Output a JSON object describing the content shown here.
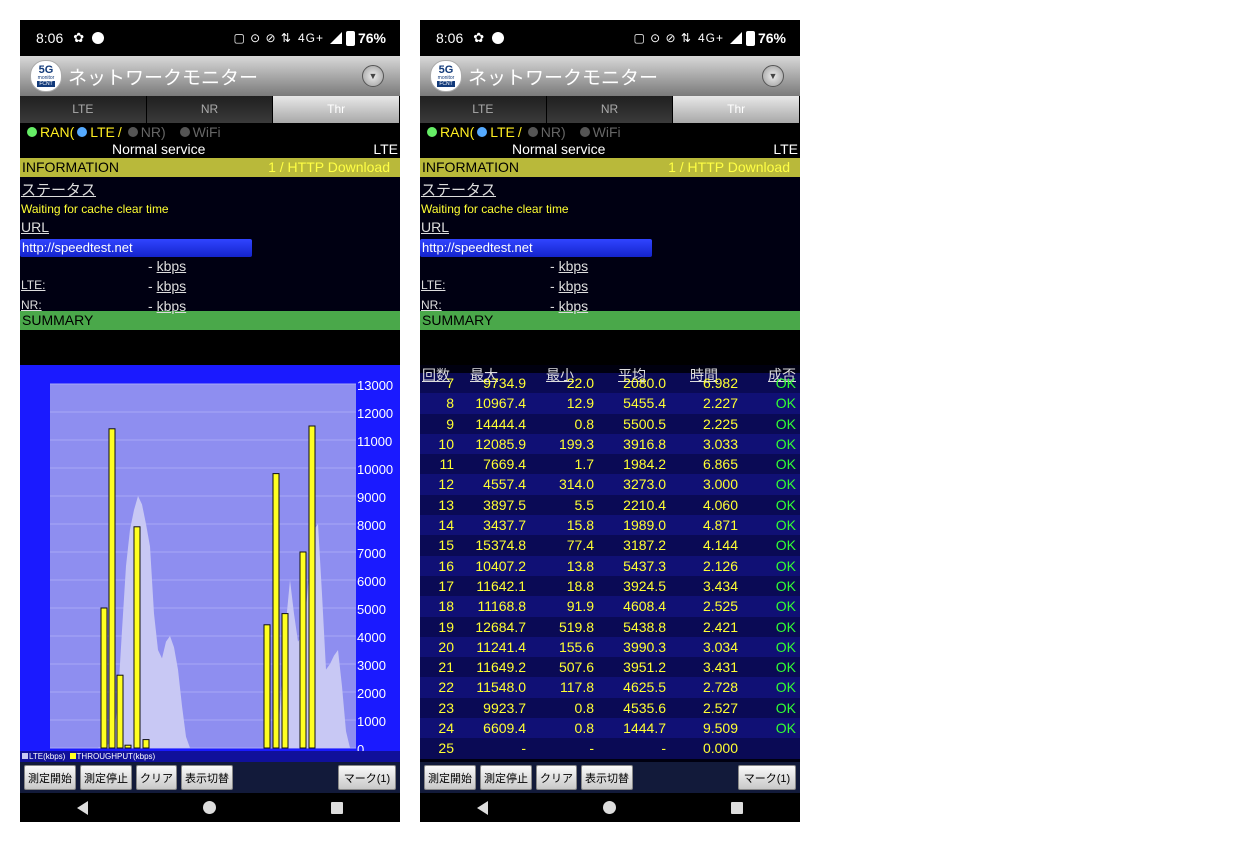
{
  "status_bar": {
    "time": "8:06",
    "network": "4G+",
    "battery": "76%"
  },
  "app": {
    "title": "ネットワークモニター",
    "logo_line1": "5G",
    "logo_line2": "monitor",
    "logo_line3": "FCNT"
  },
  "tabs": [
    "LTE",
    "NR",
    "Thr"
  ],
  "active_tab": "Thr",
  "ran": {
    "ran_label": "RAN",
    "open_paren": "(",
    "lte_label": "LTE",
    "slash": "/",
    "nr_label": "NR",
    "close_paren": ")",
    "wifi_label": "WiFi",
    "service": "Normal service",
    "network": "LTE"
  },
  "information": {
    "label": "INFORMATION",
    "value": "1 / HTTP Download",
    "status_label": "ステータス",
    "status_value": "Waiting for cache clear time",
    "url_label": "URL",
    "url_value": "http://speedtest.net",
    "total_rate": "- ",
    "lte_label": "LTE:",
    "lte_rate": "- ",
    "nr_label": "NR:",
    "nr_rate": "- ",
    "unit": "kbps"
  },
  "summary_label": "SUMMARY",
  "chart_data": {
    "type": "bar",
    "title": "",
    "ylim": [
      0,
      13000
    ],
    "y_ticks": [
      "13000",
      "12000",
      "11000",
      "10000",
      "9000",
      "8000",
      "7000",
      "6000",
      "5000",
      "4000",
      "3000",
      "2000",
      "1000",
      "0"
    ],
    "series": [
      {
        "name": "LTE(kbps)",
        "kind": "area",
        "color": "#c8c8f4",
        "values": [
          0,
          0,
          0,
          0,
          0,
          0,
          0,
          0,
          0,
          0,
          0,
          0,
          0,
          0,
          0,
          0,
          0,
          0,
          1500,
          4500,
          7500,
          9000,
          7500,
          6500,
          4800,
          3200,
          3800,
          4000,
          2000,
          800,
          0,
          0,
          0,
          0,
          0,
          0,
          0,
          0,
          0,
          0,
          0,
          0,
          0,
          0,
          0,
          0,
          0,
          0,
          0,
          0,
          0,
          0,
          0,
          0,
          0,
          0,
          0,
          0,
          0,
          0,
          0,
          0,
          0,
          0,
          0,
          0,
          0,
          0,
          0,
          0,
          0,
          0,
          0,
          0,
          0,
          0,
          0,
          0,
          0,
          0,
          0,
          0,
          0,
          0,
          0,
          0,
          0,
          0,
          0,
          0,
          0,
          0,
          0,
          0,
          0,
          0,
          0,
          0,
          0,
          0,
          0,
          0,
          0,
          0,
          0,
          0,
          0,
          0,
          0,
          0,
          0,
          0,
          0,
          0,
          0,
          0,
          0,
          0,
          0,
          0,
          0,
          0,
          0,
          0,
          0,
          0,
          0,
          0,
          0,
          0,
          0,
          0,
          0,
          0,
          0,
          0,
          0,
          0,
          0,
          0,
          0,
          0,
          0,
          0,
          0,
          0,
          0,
          0,
          0,
          0,
          0,
          0,
          0,
          0,
          0,
          0,
          0,
          0,
          0,
          0,
          0,
          0,
          0,
          0,
          0,
          0,
          0,
          0,
          0,
          0,
          0,
          0,
          0,
          0,
          0,
          0,
          0,
          0,
          0,
          0,
          0,
          0,
          0,
          0,
          0,
          0,
          0,
          0,
          0,
          0,
          0,
          0,
          0,
          0,
          0,
          0,
          0,
          0,
          0,
          0,
          0,
          0,
          0,
          0,
          0,
          0,
          0,
          0,
          0,
          0,
          0,
          0,
          0,
          0,
          0,
          0,
          0,
          0,
          0,
          0,
          0,
          0,
          0,
          0,
          0,
          0,
          0,
          0,
          0,
          0,
          0,
          0,
          0,
          0,
          0,
          0,
          0,
          0,
          0,
          0,
          0,
          0,
          0,
          0,
          0,
          0,
          0,
          0,
          0,
          0,
          0,
          0,
          0,
          0,
          0,
          0,
          0,
          0,
          0,
          0,
          0,
          0,
          0,
          0,
          0,
          0,
          0,
          0,
          0,
          0,
          0,
          0,
          0,
          0,
          0,
          0,
          0,
          0,
          0,
          0,
          0,
          0,
          0,
          0,
          0,
          0,
          0,
          0,
          0,
          0,
          0,
          0,
          0,
          0,
          0,
          0,
          0,
          0,
          0,
          0,
          0,
          0,
          0,
          0,
          0,
          0,
          0,
          0,
          0,
          0,
          0,
          0,
          0,
          0,
          0,
          0,
          0,
          0,
          0,
          0,
          0,
          0,
          0,
          0,
          0,
          0,
          0,
          0,
          0,
          0,
          0,
          0,
          0,
          0,
          0,
          0,
          0,
          0,
          0,
          0,
          0,
          0,
          0,
          0,
          0,
          0,
          0,
          0,
          0,
          0
        ]
      },
      {
        "name": "THROUGHPUT(kbps)",
        "kind": "bar",
        "color": "#ffff22",
        "values": [
          5000,
          11400,
          2600,
          100,
          7900,
          300,
          4400,
          9800,
          4800,
          7000,
          11500
        ]
      }
    ],
    "lte_area_points": [
      [
        48,
        8
      ],
      [
        52,
        40
      ],
      [
        56,
        80
      ],
      [
        60,
        180
      ],
      [
        64,
        400
      ],
      [
        68,
        1800
      ],
      [
        72,
        4200
      ],
      [
        76,
        6500
      ],
      [
        80,
        7800
      ],
      [
        84,
        8500
      ],
      [
        88,
        9000
      ],
      [
        92,
        8700
      ],
      [
        96,
        8000
      ],
      [
        100,
        7200
      ],
      [
        104,
        4800
      ],
      [
        108,
        3500
      ],
      [
        112,
        3200
      ],
      [
        116,
        3800
      ],
      [
        120,
        4000
      ],
      [
        124,
        3600
      ],
      [
        128,
        2800
      ],
      [
        132,
        1500
      ],
      [
        136,
        400
      ],
      [
        140,
        0
      ],
      [
        225,
        0
      ],
      [
        228,
        400
      ],
      [
        232,
        2500
      ],
      [
        236,
        4500
      ],
      [
        240,
        6000
      ],
      [
        244,
        4800
      ],
      [
        248,
        3800
      ],
      [
        252,
        4000
      ],
      [
        256,
        5000
      ],
      [
        260,
        6500
      ],
      [
        264,
        7800
      ],
      [
        268,
        8000
      ],
      [
        272,
        5500
      ],
      [
        276,
        2800
      ],
      [
        280,
        3000
      ],
      [
        284,
        3300
      ],
      [
        288,
        3500
      ],
      [
        292,
        2200
      ],
      [
        296,
        600
      ],
      [
        300,
        0
      ]
    ],
    "throughput_bar_positions": [
      54,
      62,
      70,
      78,
      87,
      96,
      217,
      226,
      235,
      253,
      262
    ],
    "legend": [
      "LTE(kbps)",
      "THROUGHPUT(kbps)"
    ],
    "legend_colors": [
      "#c8c8f4",
      "#ffff22"
    ]
  },
  "summary_table": {
    "headers": [
      "回数",
      "最大",
      "最小",
      "平均",
      "時間",
      "成否"
    ],
    "rows": [
      [
        "7",
        "9734.9",
        "22.0",
        "2080.0",
        "6.982",
        "OK"
      ],
      [
        "8",
        "10967.4",
        "12.9",
        "5455.4",
        "2.227",
        "OK"
      ],
      [
        "9",
        "14444.4",
        "0.8",
        "5500.5",
        "2.225",
        "OK"
      ],
      [
        "10",
        "12085.9",
        "199.3",
        "3916.8",
        "3.033",
        "OK"
      ],
      [
        "11",
        "7669.4",
        "1.7",
        "1984.2",
        "6.865",
        "OK"
      ],
      [
        "12",
        "4557.4",
        "314.0",
        "3273.0",
        "3.000",
        "OK"
      ],
      [
        "13",
        "3897.5",
        "5.5",
        "2210.4",
        "4.060",
        "OK"
      ],
      [
        "14",
        "3437.7",
        "15.8",
        "1989.0",
        "4.871",
        "OK"
      ],
      [
        "15",
        "15374.8",
        "77.4",
        "3187.2",
        "4.144",
        "OK"
      ],
      [
        "16",
        "10407.2",
        "13.8",
        "5437.3",
        "2.126",
        "OK"
      ],
      [
        "17",
        "11642.1",
        "18.8",
        "3924.5",
        "3.434",
        "OK"
      ],
      [
        "18",
        "11168.8",
        "91.9",
        "4608.4",
        "2.525",
        "OK"
      ],
      [
        "19",
        "12684.7",
        "519.8",
        "5438.8",
        "2.421",
        "OK"
      ],
      [
        "20",
        "11241.4",
        "155.6",
        "3990.3",
        "3.034",
        "OK"
      ],
      [
        "21",
        "11649.2",
        "507.6",
        "3951.2",
        "3.431",
        "OK"
      ],
      [
        "22",
        "11548.0",
        "117.8",
        "4625.5",
        "2.728",
        "OK"
      ],
      [
        "23",
        "9923.7",
        "0.8",
        "4535.6",
        "2.527",
        "OK"
      ],
      [
        "24",
        "6609.4",
        "0.8",
        "1444.7",
        "9.509",
        "OK"
      ],
      [
        "25",
        "-",
        "-",
        "-",
        "0.000",
        ""
      ]
    ]
  },
  "buttons": {
    "start": "測定開始",
    "stop": "測定停止",
    "clear": "クリア",
    "toggle": "表示切替",
    "mark": "マーク(1)"
  }
}
